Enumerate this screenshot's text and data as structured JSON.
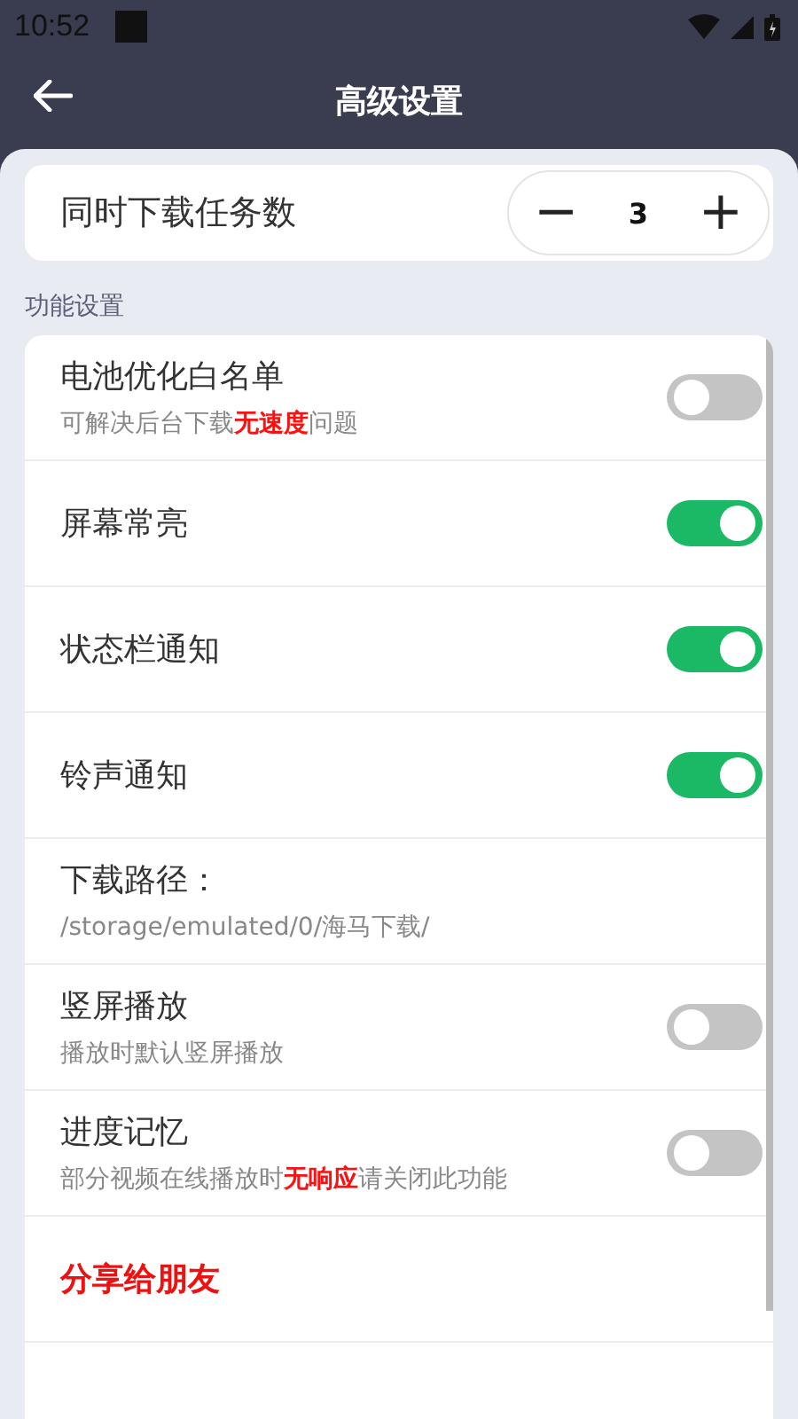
{
  "status_bar": {
    "time": "10:52"
  },
  "header": {
    "title": "高级设置"
  },
  "task_count": {
    "label": "同时下载任务数",
    "minus": "−",
    "value": "3",
    "plus": "+"
  },
  "section": {
    "title": "功能设置"
  },
  "settings": [
    {
      "kind": "toggle",
      "title": "电池优化白名单",
      "subtitle": "可解决后台下载**无速度**问题",
      "on": false
    },
    {
      "kind": "toggle",
      "title": "屏幕常亮",
      "on": true
    },
    {
      "kind": "toggle",
      "title": "状态栏通知",
      "on": true
    },
    {
      "kind": "toggle",
      "title": "铃声通知",
      "on": true
    },
    {
      "kind": "path",
      "title": "下载路径：",
      "subtitle": "/storage/emulated/0/海马下载/"
    },
    {
      "kind": "toggle",
      "title": "竖屏播放",
      "subtitle": "播放时默认竖屏播放",
      "on": false
    },
    {
      "kind": "toggle",
      "title": "进度记忆",
      "subtitle": "部分视频在线播放时**无响应**请关闭此功能",
      "on": false
    },
    {
      "kind": "link",
      "title": "分享给朋友"
    },
    {
      "kind": "empty"
    }
  ]
}
